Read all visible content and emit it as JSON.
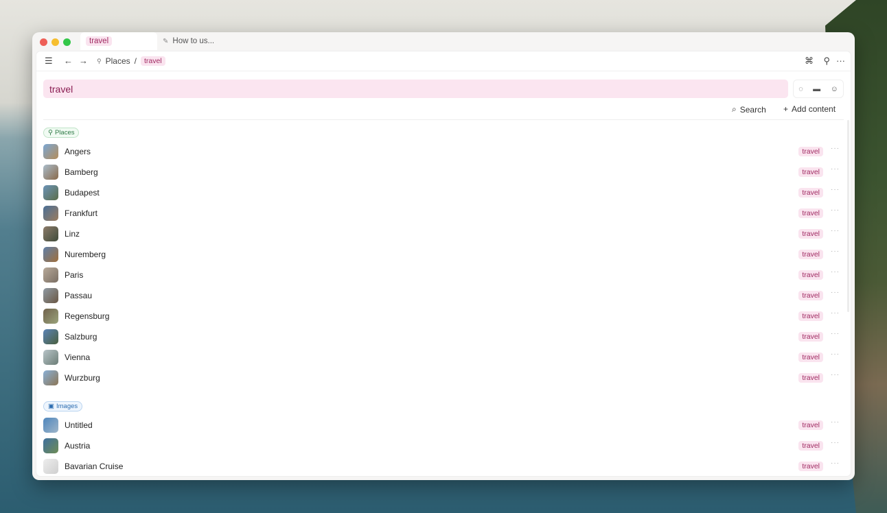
{
  "window": {
    "tabs": [
      {
        "label": "travel",
        "active": true
      },
      {
        "label": "How to us...",
        "active": false
      }
    ]
  },
  "nav": {
    "breadcrumb": {
      "parent": "Places",
      "separator": "/",
      "current": "travel"
    }
  },
  "page": {
    "title": "travel",
    "search_label": "Search",
    "add_label": "Add content"
  },
  "sections": [
    {
      "label": "Places",
      "items": [
        {
          "name": "Angers",
          "tag": "travel"
        },
        {
          "name": "Bamberg",
          "tag": "travel"
        },
        {
          "name": "Budapest",
          "tag": "travel"
        },
        {
          "name": "Frankfurt",
          "tag": "travel"
        },
        {
          "name": "Linz",
          "tag": "travel"
        },
        {
          "name": "Nuremberg",
          "tag": "travel"
        },
        {
          "name": "Paris",
          "tag": "travel"
        },
        {
          "name": "Passau",
          "tag": "travel"
        },
        {
          "name": "Regensburg",
          "tag": "travel"
        },
        {
          "name": "Salzburg",
          "tag": "travel"
        },
        {
          "name": "Vienna",
          "tag": "travel"
        },
        {
          "name": "Wurzburg",
          "tag": "travel"
        }
      ]
    },
    {
      "label": "Images",
      "items": [
        {
          "name": "Untitled",
          "tag": "travel"
        },
        {
          "name": "Austria",
          "tag": "travel"
        },
        {
          "name": "Bavarian Cruise",
          "tag": "travel"
        }
      ]
    }
  ],
  "colors": {
    "tag_bg": "#fae4ef",
    "tag_text": "#a02a62",
    "places_accent": "#2d7a45",
    "images_accent": "#2b6cb0"
  }
}
